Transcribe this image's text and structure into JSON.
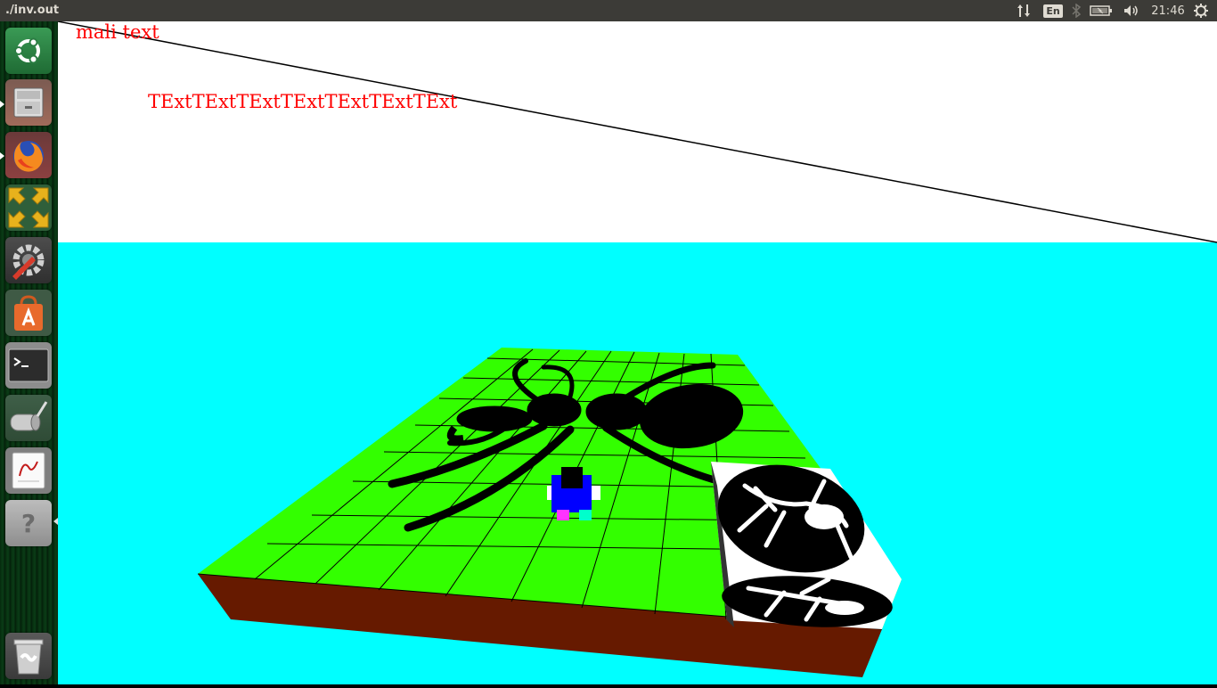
{
  "window": {
    "title": "./inv.out"
  },
  "top_panel": {
    "network_icon": "network-updown-icon",
    "keyboard_language": "En",
    "bluetooth_icon": "bluetooth-icon",
    "battery_icon": "battery-icon",
    "volume_icon": "volume-icon",
    "clock": "21:46",
    "settings_icon": "power-gear-icon"
  },
  "launcher": {
    "items": [
      {
        "name": "ubuntu-dash",
        "icon": "ubuntu-logo-icon"
      },
      {
        "name": "files",
        "icon": "file-cabinet-icon"
      },
      {
        "name": "firefox",
        "icon": "firefox-icon"
      },
      {
        "name": "workspace-switcher",
        "icon": "workspace-arrows-icon"
      },
      {
        "name": "system-settings",
        "icon": "wrench-gear-icon"
      },
      {
        "name": "software-center",
        "icon": "shopping-bag-icon"
      },
      {
        "name": "terminal",
        "icon": "terminal-icon"
      },
      {
        "name": "system-tool",
        "icon": "roller-icon"
      },
      {
        "name": "document-viewer",
        "icon": "document-icon"
      },
      {
        "name": "help",
        "icon": "question-mark-icon"
      },
      {
        "name": "trash",
        "icon": "trash-icon"
      }
    ]
  },
  "scene": {
    "text_small": "mali text",
    "text_large": "TExtTExtTExtTExtTExtTExtTExt",
    "sky_color": "#ffffff",
    "background_color": "#00ffff",
    "ground_color": "#33ff00",
    "base_color": "#661a00",
    "text_color": "#ff0000"
  }
}
